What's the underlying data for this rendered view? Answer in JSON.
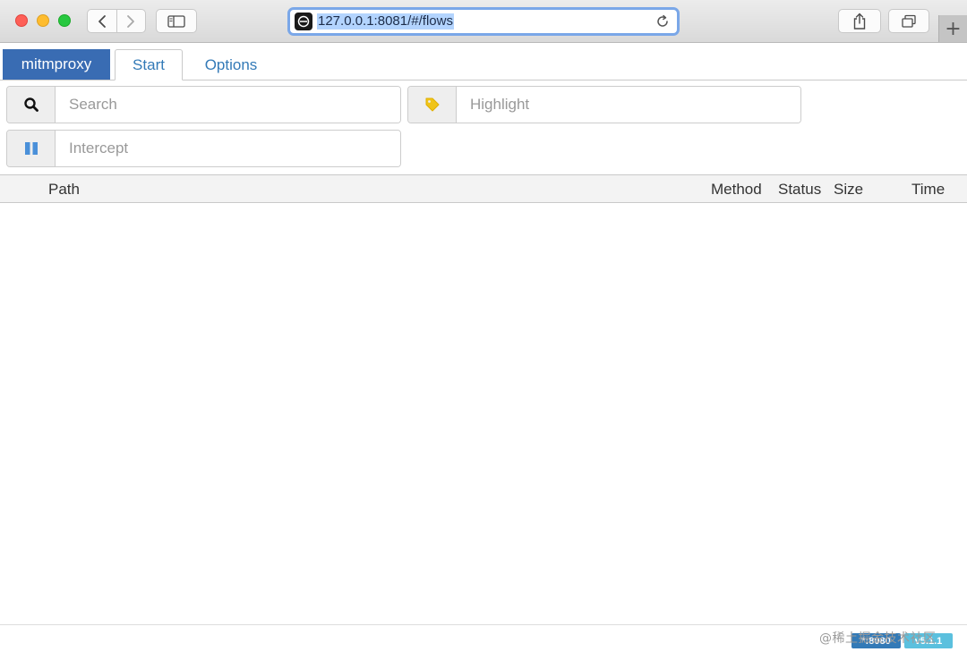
{
  "browser": {
    "url": "127.0.0.1:8081/#/flows",
    "new_tab_label": "+"
  },
  "app": {
    "brand": "mitmproxy",
    "tabs": [
      {
        "label": "Start",
        "active": true
      },
      {
        "label": "Options",
        "active": false
      }
    ]
  },
  "filters": {
    "search": {
      "placeholder": "Search",
      "icon": "search-icon"
    },
    "highlight": {
      "placeholder": "Highlight",
      "icon": "tag-icon"
    },
    "intercept": {
      "placeholder": "Intercept",
      "icon": "pause-icon"
    }
  },
  "flow_table": {
    "columns": [
      "Path",
      "Method",
      "Status",
      "Size",
      "Time"
    ],
    "rows": []
  },
  "footer": {
    "port_badge": "*:8080",
    "version_badge": "v5.1.1",
    "watermark": "@稀土掘金技术社区"
  },
  "colors": {
    "brand": "#396cb3",
    "link": "#337ab7",
    "highlight_icon": "#f0c419",
    "intercept_icon": "#4a90d9"
  }
}
